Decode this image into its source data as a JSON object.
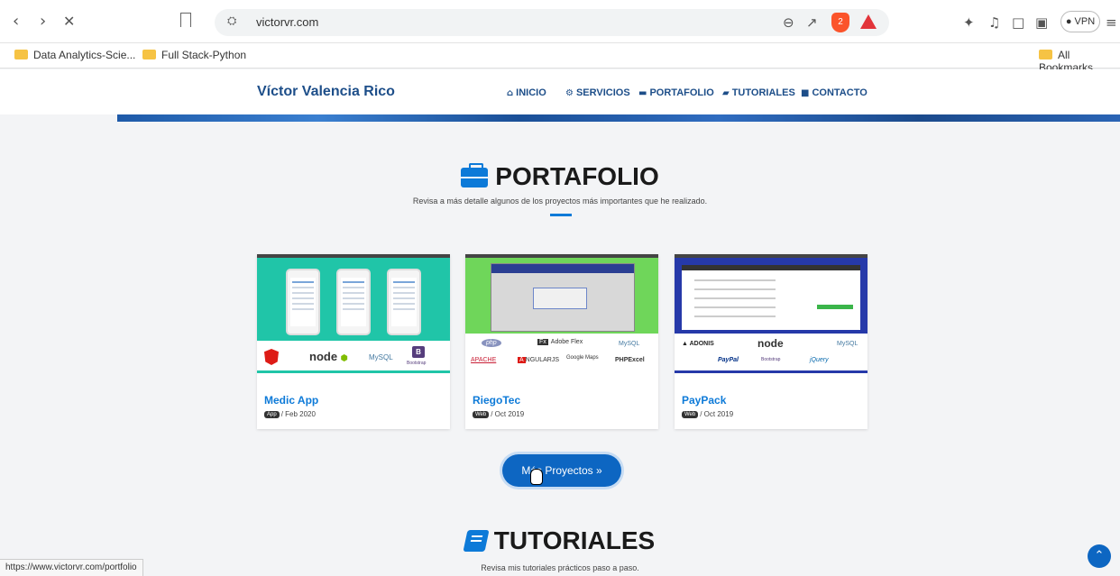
{
  "browser": {
    "url": "victorvr.com",
    "vpn_label": "VPN",
    "brave_badge": "2",
    "bookmarks": [
      {
        "label": "Data Analytics-Scie..."
      },
      {
        "label": "Full Stack-Python"
      }
    ],
    "all_bookmarks": "All Bookmarks",
    "status_url": "https://www.victorvr.com/portfolio"
  },
  "site": {
    "brand": "Víctor Valencia Rico",
    "nav": [
      {
        "label": "INICIO",
        "icon": "home-icon"
      },
      {
        "label": "SERVICIOS",
        "icon": "cogs-icon"
      },
      {
        "label": "PORTAFOLIO",
        "icon": "briefcase-icon"
      },
      {
        "label": "TUTORIALES",
        "icon": "book-icon"
      },
      {
        "label": "CONTACTO",
        "icon": "contact-card-icon"
      }
    ]
  },
  "portfolio": {
    "title": "PORTAFOLIO",
    "subtitle": "Revisa a más detalle algunos de los proyectos más importantes que he realizado.",
    "projects": [
      {
        "title": "Medic App",
        "tag": "App",
        "date": "/ Feb 2020",
        "logos": [
          "node",
          "MySQL",
          "Bootstrap"
        ]
      },
      {
        "title": "RiegoTec",
        "tag": "Web",
        "date": "/ Oct 2019",
        "logos": [
          "php",
          "Adobe Flex",
          "MySQL",
          "APACHE",
          "NGULARJS",
          "Google Maps",
          "PHPExcel"
        ]
      },
      {
        "title": "PayPack",
        "tag": "Web",
        "date": "/ Oct 2019",
        "logos": [
          "ADONIS",
          "node",
          "MySQL",
          "PayPal",
          "Bootstrap",
          "jQuery"
        ]
      }
    ],
    "more_button": "Más Proyectos »"
  },
  "tutorials": {
    "title": "TUTORIALES",
    "subtitle": "Revisa mis tutoriales prácticos paso a paso."
  }
}
